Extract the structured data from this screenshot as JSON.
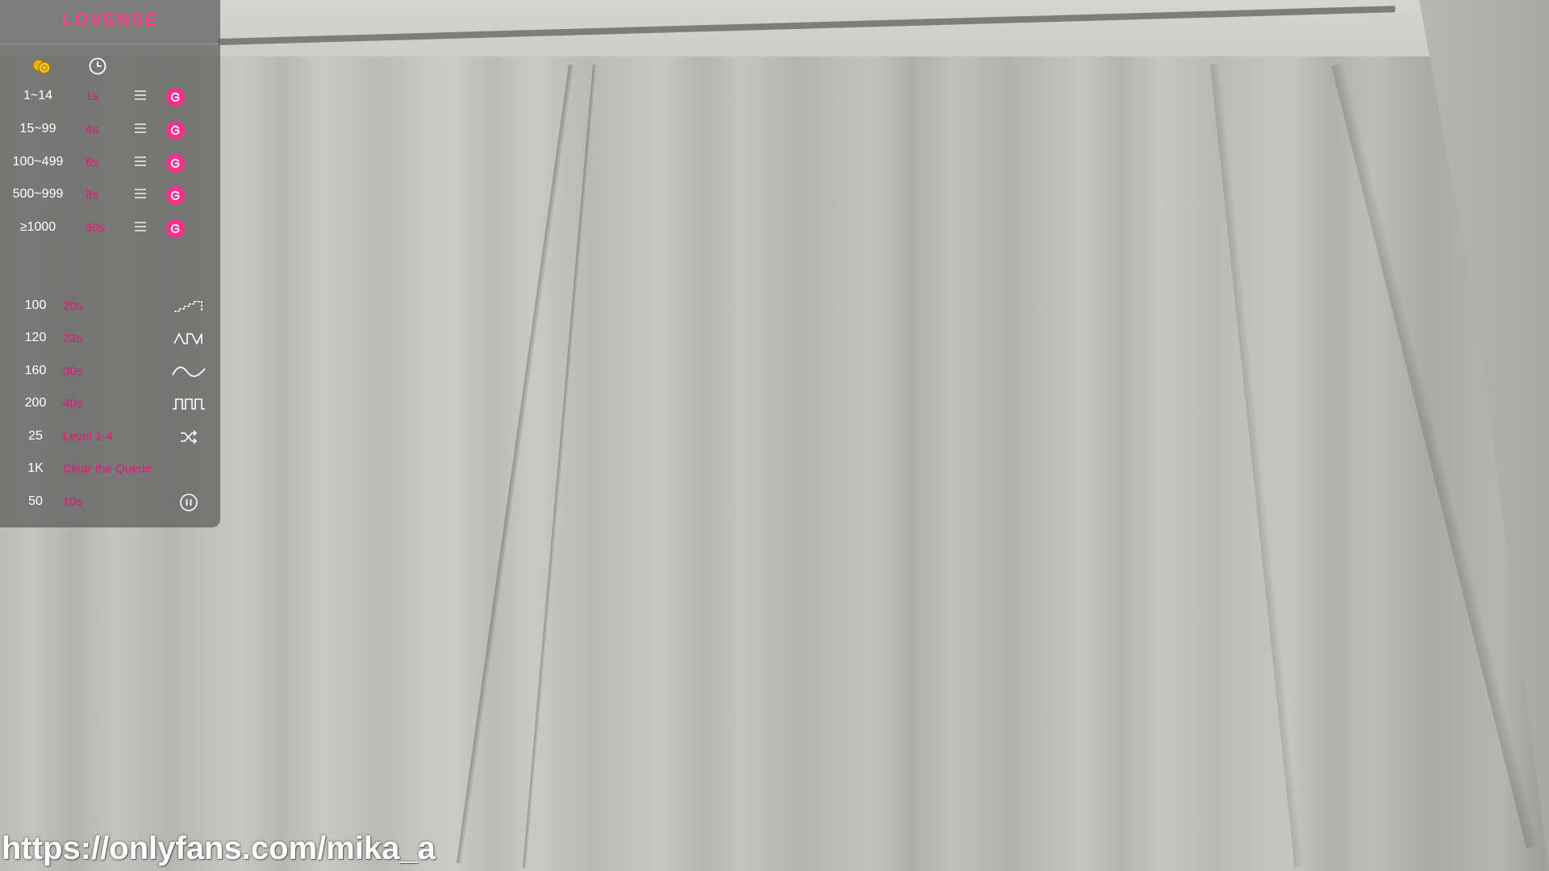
{
  "overlay": {
    "brand": "LOVENSE",
    "tabs": [
      {
        "icon": "coins-icon"
      },
      {
        "icon": "clock-icon"
      }
    ],
    "tip_levels": [
      {
        "amount": "1~14",
        "duration": "1s",
        "icon": "lovense-icon"
      },
      {
        "amount": "15~99",
        "duration": "4s",
        "icon": "lovense-icon"
      },
      {
        "amount": "100~499",
        "duration": "6s",
        "icon": "lovense-icon"
      },
      {
        "amount": "500~999",
        "duration": "8s",
        "icon": "lovense-icon"
      },
      {
        "amount": "≥1000",
        "duration": "30s",
        "icon": "lovense-icon"
      }
    ],
    "special_commands": [
      {
        "amount": "100",
        "label": "20s",
        "icon": "pattern-stairs-icon"
      },
      {
        "amount": "120",
        "label": "22s",
        "icon": "pattern-pulse-icon"
      },
      {
        "amount": "160",
        "label": "30s",
        "icon": "pattern-wave-icon"
      },
      {
        "amount": "200",
        "label": "40s",
        "icon": "pattern-square-icon"
      },
      {
        "amount": "25",
        "label": "Level 1-4",
        "icon": "random-icon"
      },
      {
        "amount": "1K",
        "label": "Clear the Queue",
        "icon": ""
      },
      {
        "amount": "50",
        "label": "10s",
        "icon": "pause-icon"
      }
    ],
    "colors": {
      "brand": "#ff3d8e",
      "duration_text": "#e8147a",
      "panel_bg": "#5c5c5c"
    }
  },
  "watermark": "https://onlyfans.com/mika_a"
}
